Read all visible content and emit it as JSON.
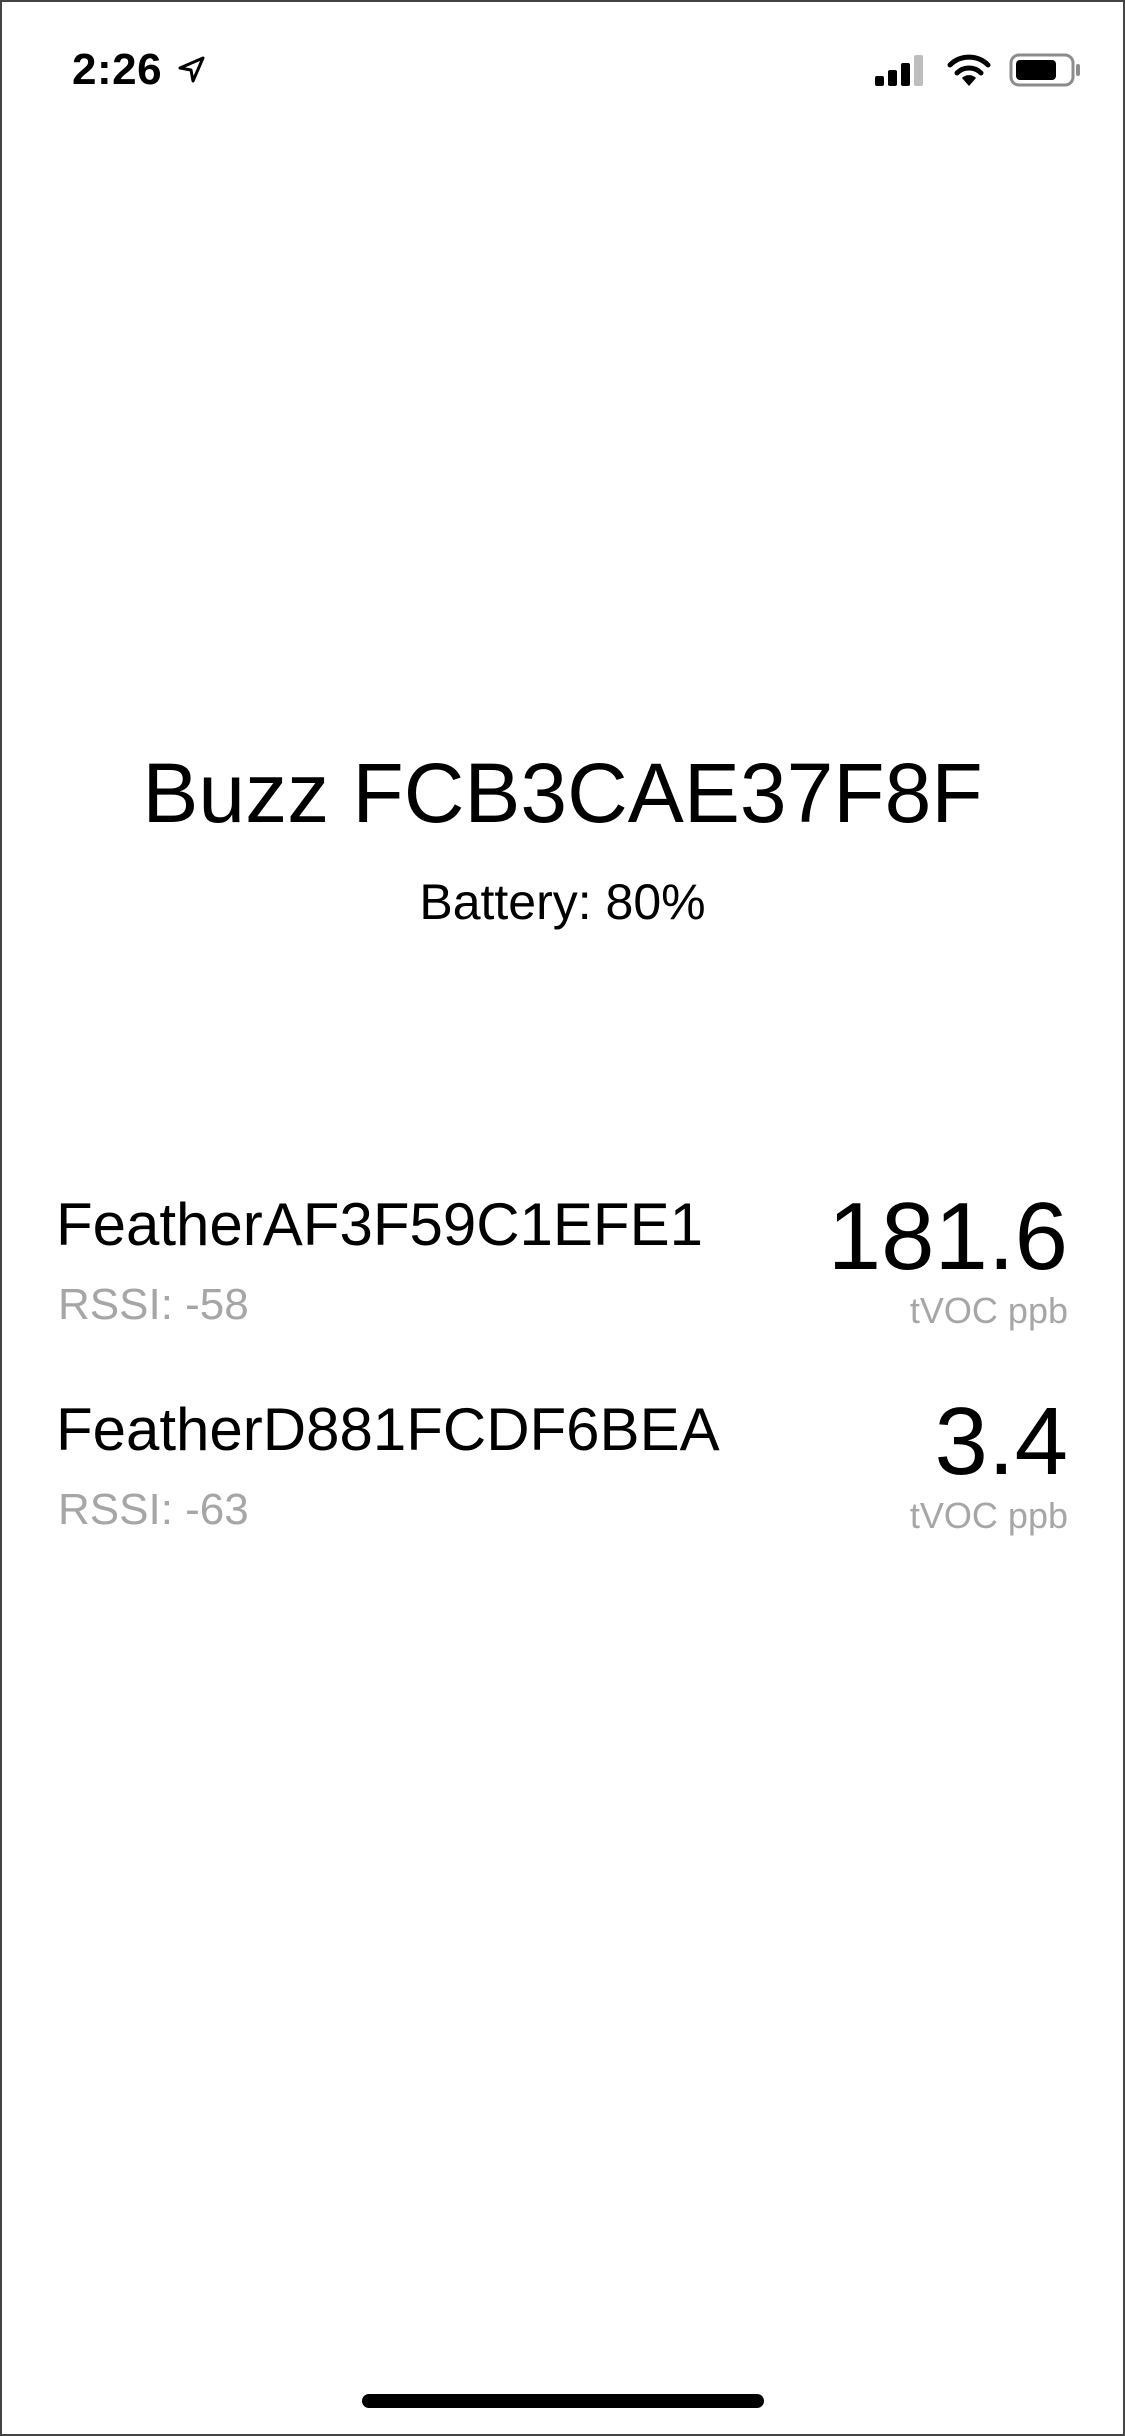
{
  "status_bar": {
    "time": "2:26",
    "icons": [
      "location-arrow-icon",
      "cellular-signal-icon",
      "wifi-icon",
      "battery-icon"
    ]
  },
  "header": {
    "title": "Buzz FCB3CAE37F8F",
    "battery": "Battery: 80%"
  },
  "sensors": [
    {
      "name": "FeatherAF3F59C1EFE1",
      "rssi": "RSSI: -58",
      "value": "181.6",
      "unit": "tVOC ppb"
    },
    {
      "name": "FeatherD881FCDF6BEA",
      "rssi": "RSSI: -63",
      "value": "3.4",
      "unit": "tVOC ppb"
    }
  ],
  "colors": {
    "text": "#000000",
    "secondary_text": "#a6a6a6",
    "background": "#ffffff"
  }
}
